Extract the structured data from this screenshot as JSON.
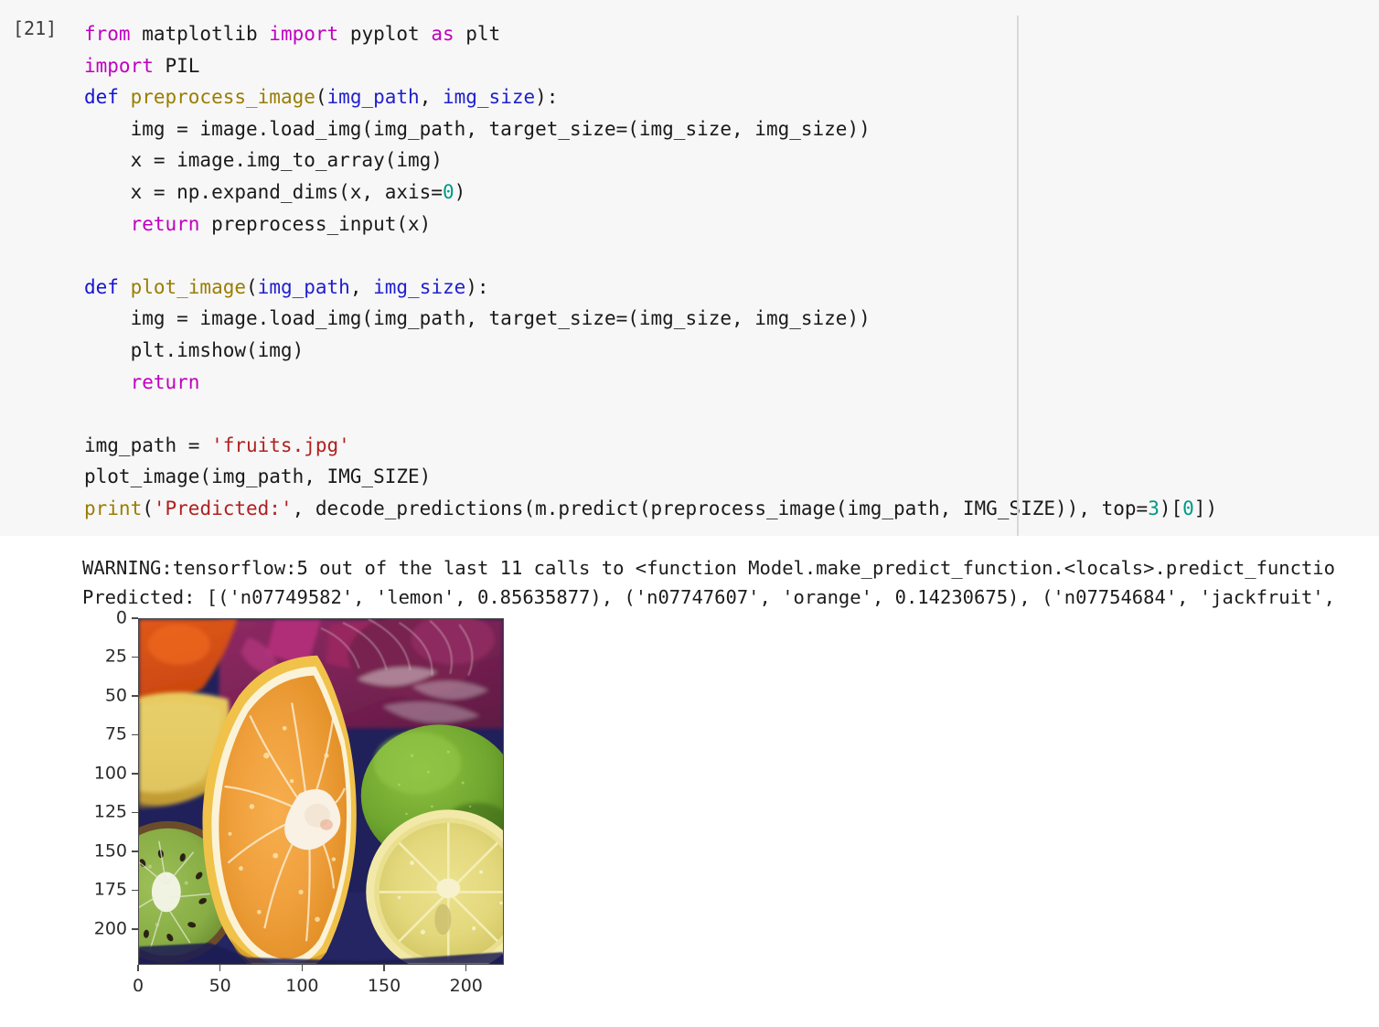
{
  "notebook": {
    "cell": {
      "prompt": "[21]",
      "code_lines": [
        [
          {
            "t": "from ",
            "c": "kw"
          },
          {
            "t": "matplotlib ",
            "c": "plain"
          },
          {
            "t": "import ",
            "c": "kw"
          },
          {
            "t": "pyplot ",
            "c": "plain"
          },
          {
            "t": "as ",
            "c": "kw"
          },
          {
            "t": "plt",
            "c": "plain"
          }
        ],
        [
          {
            "t": "import ",
            "c": "kw"
          },
          {
            "t": "PIL",
            "c": "plain"
          }
        ],
        [
          {
            "t": "def ",
            "c": "def"
          },
          {
            "t": "preprocess_image",
            "c": "fn"
          },
          {
            "t": "(",
            "c": "plain"
          },
          {
            "t": "img_path",
            "c": "param"
          },
          {
            "t": ", ",
            "c": "plain"
          },
          {
            "t": "img_size",
            "c": "param"
          },
          {
            "t": "):",
            "c": "plain"
          }
        ],
        [
          {
            "t": "    img = image.load_img(img_path, target_size=(img_size, img_size))",
            "c": "plain"
          }
        ],
        [
          {
            "t": "    x = image.img_to_array(img)",
            "c": "plain"
          }
        ],
        [
          {
            "t": "    x = np.expand_dims(x, axis=",
            "c": "plain"
          },
          {
            "t": "0",
            "c": "num"
          },
          {
            "t": ")",
            "c": "plain"
          }
        ],
        [
          {
            "t": "    ",
            "c": "plain"
          },
          {
            "t": "return ",
            "c": "kw"
          },
          {
            "t": "preprocess_input(x)",
            "c": "plain"
          }
        ],
        [
          {
            "t": "",
            "c": "plain"
          }
        ],
        [
          {
            "t": "def ",
            "c": "def"
          },
          {
            "t": "plot_image",
            "c": "fn"
          },
          {
            "t": "(",
            "c": "plain"
          },
          {
            "t": "img_path",
            "c": "param"
          },
          {
            "t": ", ",
            "c": "plain"
          },
          {
            "t": "img_size",
            "c": "param"
          },
          {
            "t": "):",
            "c": "plain"
          }
        ],
        [
          {
            "t": "    img = image.load_img(img_path, target_size=(img_size, img_size))",
            "c": "plain"
          }
        ],
        [
          {
            "t": "    plt.imshow(img)",
            "c": "plain"
          }
        ],
        [
          {
            "t": "    ",
            "c": "plain"
          },
          {
            "t": "return",
            "c": "kw"
          }
        ],
        [
          {
            "t": "",
            "c": "plain"
          }
        ],
        [
          {
            "t": "img_path = ",
            "c": "plain"
          },
          {
            "t": "'fruits.jpg'",
            "c": "str"
          }
        ],
        [
          {
            "t": "plot_image(img_path, IMG_SIZE)",
            "c": "plain"
          }
        ],
        [
          {
            "t": "print",
            "c": "fn"
          },
          {
            "t": "(",
            "c": "plain"
          },
          {
            "t": "'Predicted:'",
            "c": "str"
          },
          {
            "t": ", decode_predictions(m.predict(preprocess_image(img_path, IMG_SIZE)), top=",
            "c": "plain"
          },
          {
            "t": "3",
            "c": "num"
          },
          {
            "t": ")[",
            "c": "plain"
          },
          {
            "t": "0",
            "c": "num"
          },
          {
            "t": "])",
            "c": "plain"
          }
        ]
      ]
    },
    "output": {
      "lines": [
        "WARNING:tensorflow:5 out of the last 11 calls to <function Model.make_predict_function.<locals>.predict_functio",
        "Predicted: [('n07749582', 'lemon', 0.85635877), ('n07747607', 'orange', 0.14230675), ('n07754684', 'jackfruit',"
      ]
    }
  },
  "chart_data": {
    "type": "image",
    "title": "",
    "xlabel": "",
    "ylabel": "",
    "xlim": [
      0,
      223
    ],
    "ylim": [
      223,
      0
    ],
    "xticks": [
      "0",
      "50",
      "100",
      "150",
      "200"
    ],
    "xtick_values": [
      0,
      50,
      100,
      150,
      200
    ],
    "yticks": [
      "0",
      "25",
      "50",
      "75",
      "100",
      "125",
      "150",
      "175",
      "200"
    ],
    "ytick_values": [
      0,
      25,
      50,
      75,
      100,
      125,
      150,
      175,
      200
    ],
    "grid": false,
    "legend": null,
    "description": "Photograph of sliced fruits: an orange wedge in the centre, kiwi half at lower-left, whole lime and a lemon half at the right, red cabbage and an orange at the top, on a blue cloth."
  },
  "colors": {
    "cell_background": "#f7f7f7",
    "divider": "#d8d8d8",
    "keyword": "#c000c0",
    "def_keyword": "#1515d0",
    "function_name": "#9a7d00",
    "parameter": "#2020cf",
    "string": "#b02020",
    "number": "#009985",
    "text": "#1a1a1a"
  }
}
